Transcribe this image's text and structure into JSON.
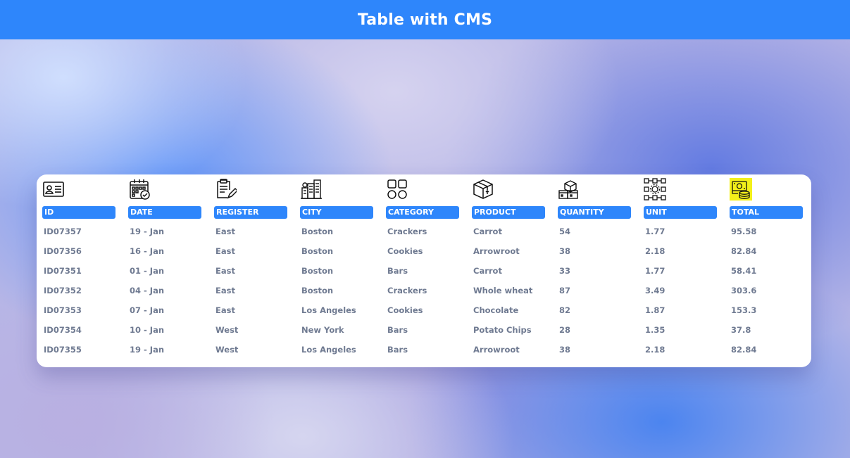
{
  "header": {
    "title": "Table with CMS",
    "background": "#2e86fb"
  },
  "table": {
    "accent": "#2e86fb",
    "highlight": "#f3f01a",
    "columns": [
      {
        "label": "ID",
        "icon": "id-card-icon"
      },
      {
        "label": "DATE",
        "icon": "calendar-icon"
      },
      {
        "label": "REGISTER",
        "icon": "clipboard-icon"
      },
      {
        "label": "CITY",
        "icon": "city-buildings-icon"
      },
      {
        "label": "CATEGORY",
        "icon": "category-grid-icon"
      },
      {
        "label": "PRODUCT",
        "icon": "product-box-icon"
      },
      {
        "label": "QUANTITY",
        "icon": "stacked-boxes-icon"
      },
      {
        "label": "UNIT",
        "icon": "unit-gear-network-icon"
      },
      {
        "label": "TOTAL",
        "icon": "money-coins-icon"
      }
    ],
    "rows": [
      [
        "ID07357",
        "19 - Jan",
        "East",
        "Boston",
        "Crackers",
        "Carrot",
        "54",
        "1.77",
        "95.58"
      ],
      [
        "ID07356",
        "16 - Jan",
        "East",
        "Boston",
        "Cookies",
        "Arrowroot",
        "38",
        "2.18",
        "82.84"
      ],
      [
        "ID07351",
        "01 - Jan",
        "East",
        "Boston",
        "Bars",
        "Carrot",
        "33",
        "1.77",
        "58.41"
      ],
      [
        "ID07352",
        "04 - Jan",
        "East",
        "Boston",
        "Crackers",
        "Whole wheat",
        "87",
        "3.49",
        "303.6"
      ],
      [
        "ID07353",
        "07 - Jan",
        "East",
        "Los Angeles",
        "Cookies",
        "Chocolate",
        "82",
        "1.87",
        "153.3"
      ],
      [
        "ID07354",
        "10 - Jan",
        "West",
        "New York",
        "Bars",
        "Potato Chips",
        "28",
        "1.35",
        "37.8"
      ],
      [
        "ID07355",
        "19 - Jan",
        "West",
        "Los Angeles",
        "Bars",
        "Arrowroot",
        "38",
        "2.18",
        "82.84"
      ]
    ]
  }
}
